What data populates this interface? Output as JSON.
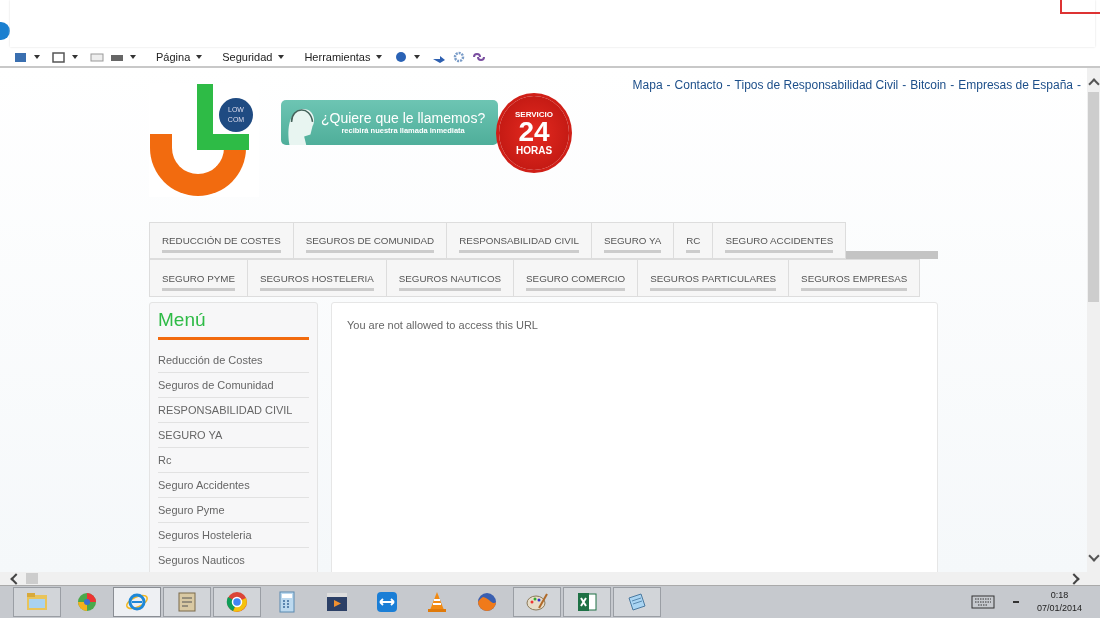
{
  "toolbar": {
    "items": [
      {
        "kind": "home",
        "caret": true
      },
      {
        "kind": "feed",
        "caret": true
      },
      {
        "kind": "mail",
        "caret": false
      },
      {
        "kind": "print",
        "caret": true
      },
      {
        "kind": "menu",
        "label": "Página",
        "caret": true
      },
      {
        "kind": "menu",
        "label": "Seguridad",
        "caret": true
      },
      {
        "kind": "menu",
        "label": "Herramientas",
        "caret": true
      },
      {
        "kind": "help",
        "caret": true
      },
      {
        "kind": "research",
        "caret": false
      },
      {
        "kind": "gear",
        "caret": false
      },
      {
        "kind": "link",
        "caret": false
      }
    ]
  },
  "top_links": [
    {
      "label": "Mapa",
      "separator": "-"
    },
    {
      "label": "Contacto",
      "separator": "-"
    },
    {
      "label": "Tipos de Responsabilidad Civil",
      "separator": "-"
    },
    {
      "label": "Bitcoin",
      "separator": "-"
    },
    {
      "label": "Empresas de España",
      "separator": "-"
    }
  ],
  "logo": {
    "badge": "LOW COM"
  },
  "banner": {
    "title": "¿Quiere que le llamemos?",
    "subtitle": "recibirá nuestra llamada inmediata"
  },
  "service_badge": {
    "top": "SERVICIO",
    "number": "24",
    "bottom": "HORAS"
  },
  "nav_rows": [
    [
      "REDUCCIÓN DE COSTES",
      "SEGUROS DE COMUNIDAD",
      "RESPONSABILIDAD CIVIL",
      "SEGURO YA",
      "RC",
      "SEGURO ACCIDENTES"
    ],
    [
      "SEGURO PYME",
      "SEGUROS HOSTELERIA",
      "SEGUROS NAUTICOS",
      "SEGURO COMERCIO",
      "SEGUROS PARTICULARES",
      "SEGUROS EMPRESAS"
    ]
  ],
  "sidebar": {
    "title": "Menú",
    "items": [
      "Reducción de Costes",
      "Seguros de Comunidad",
      "RESPONSABILIDAD CIVIL",
      "SEGURO YA",
      "Rc",
      "Seguro Accidentes",
      "Seguro Pyme",
      "Seguros Hosteleria",
      "Seguros Nauticos"
    ]
  },
  "message": "You are not allowed to access this URL",
  "taskbar": {
    "apps": [
      {
        "kind": "folder",
        "open": true,
        "selected": false
      },
      {
        "kind": "ball",
        "open": false,
        "selected": false
      },
      {
        "kind": "ebrowser",
        "open": true,
        "selected": true
      },
      {
        "kind": "paper",
        "open": true,
        "selected": false
      },
      {
        "kind": "roundbrowser",
        "open": true,
        "selected": false
      },
      {
        "kind": "calculator",
        "open": false,
        "selected": false
      },
      {
        "kind": "film",
        "open": false,
        "selected": false
      },
      {
        "kind": "arrows",
        "open": false,
        "selected": false
      },
      {
        "kind": "cone",
        "open": false,
        "selected": false
      },
      {
        "kind": "fireball",
        "open": false,
        "selected": false
      },
      {
        "kind": "palette",
        "open": true,
        "selected": false
      },
      {
        "kind": "sheet",
        "open": true,
        "selected": false
      },
      {
        "kind": "notepad",
        "open": true,
        "selected": false
      }
    ],
    "time": "0:18",
    "date": "07/01/2014"
  }
}
